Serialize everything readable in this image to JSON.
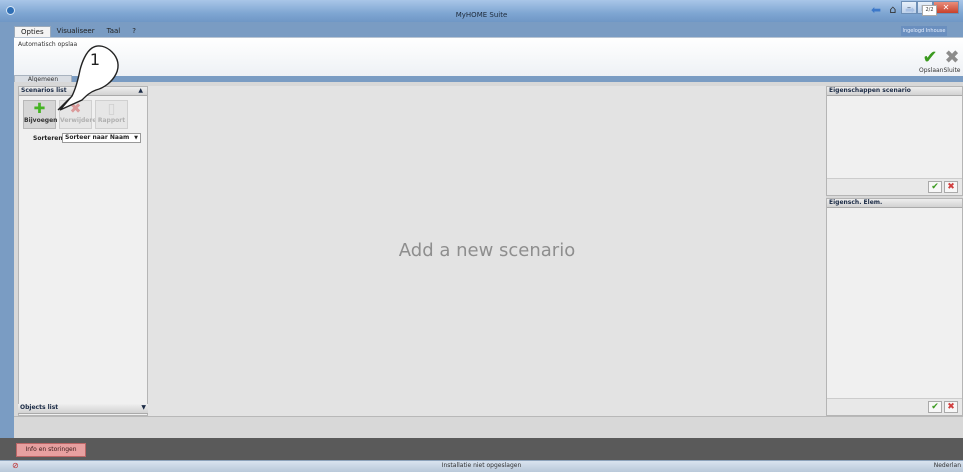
{
  "window": {
    "title": "MyHOME Suite",
    "badge": "Ingelogd Inhouse"
  },
  "menu": [
    "Opties",
    "Visualiseer",
    "Taal",
    "?"
  ],
  "ribbon": {
    "autosave_label": "Automatisch opslaa",
    "tab_label": "Algemeen",
    "save_label": "Opslaan",
    "close_label": "Sluite"
  },
  "left_panel": {
    "title": "Scenarios list",
    "tools": {
      "add": "Bijvoegen",
      "remove": "Verwijdere",
      "report": "Rapport"
    },
    "sort_label": "Sorteren",
    "sort_value": "Sorteer naar Naam",
    "objects_title": "Objects list"
  },
  "canvas": {
    "empty_message": "Add a new scenario"
  },
  "right_panels": {
    "scenario_title": "Eigenschappen scenario",
    "element_title": "Eigensch. Elem."
  },
  "nav": {
    "page_indicator": "2/2"
  },
  "bottom": {
    "info_button": "Info en storingen"
  },
  "status": {
    "text": "Installatie niet opgeslagen",
    "language": "Nederlan"
  },
  "callout": {
    "number": "1"
  },
  "colors": {
    "accent_green": "#3b9a1f",
    "info_red": "#e7a0a0",
    "titlebar_blue": "#7fa6d2"
  }
}
